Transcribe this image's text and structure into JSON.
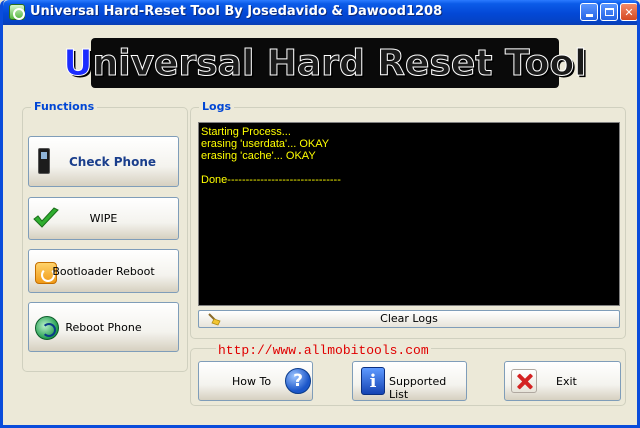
{
  "window": {
    "title": "Universal Hard-Reset Tool By Josedavido & Dawood1208",
    "icon": "app-icon",
    "controls": [
      "minimize-icon",
      "maximize-icon",
      "close-icon"
    ]
  },
  "banner": {
    "first_letter": "U",
    "rest": "niversal Hard Reset Tool"
  },
  "functions": {
    "legend": "Functions",
    "buttons": [
      {
        "label": "Check Phone",
        "icon": "phone-icon"
      },
      {
        "label": "WIPE",
        "icon": "checkmark-icon"
      },
      {
        "label": "Bootloader Reboot",
        "icon": "bootloader-icon"
      },
      {
        "label": "Reboot Phone",
        "icon": "reboot-icon"
      }
    ]
  },
  "logs": {
    "legend": "Logs",
    "lines": [
      "Starting Process...",
      "erasing 'userdata'... OKAY",
      "erasing 'cache'... OKAY",
      "",
      "Done-------------------------------"
    ],
    "clear_label": "Clear Logs",
    "text_color": "#ffff00",
    "background": "#000000"
  },
  "link": {
    "text": "http://www.allmobitools.com",
    "color": "#e00000"
  },
  "actions": [
    {
      "label": "How To",
      "icon": "help-icon"
    },
    {
      "label": "Supported List",
      "icon": "info-icon"
    },
    {
      "label": "Exit",
      "icon": "exit-icon"
    }
  ],
  "colors": {
    "titlebar": "#0348d6",
    "window_bg": "#ece9d8",
    "legend": "#0046d5"
  }
}
